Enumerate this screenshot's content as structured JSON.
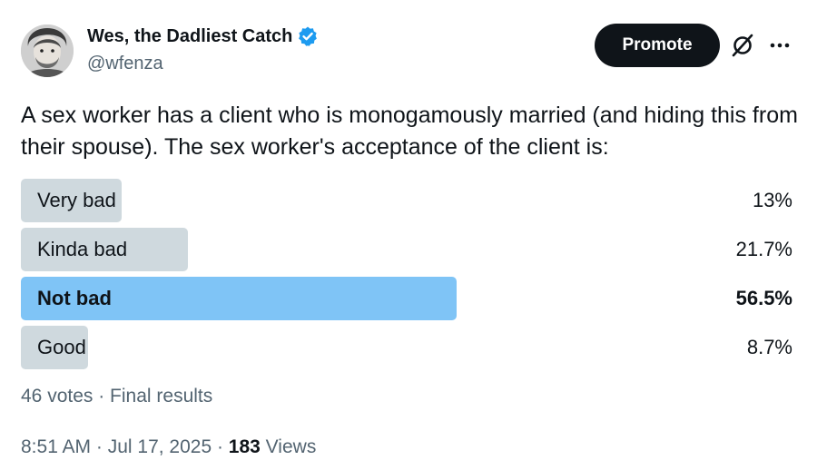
{
  "author": {
    "display_name": "Wes, the Dadliest Catch",
    "handle": "@wfenza",
    "verified": true
  },
  "actions": {
    "promote_label": "Promote",
    "icons": [
      "grok-icon",
      "more-icon"
    ]
  },
  "tweet": {
    "text": "A sex worker has a client who is monogamously married (and hiding this from their spouse). The sex worker's acceptance of the client is:"
  },
  "poll": {
    "options": [
      {
        "label": "Very bad",
        "percent_text": "13%",
        "percent": 13,
        "winner": false
      },
      {
        "label": "Kinda bad",
        "percent_text": "21.7%",
        "percent": 21.7,
        "winner": false
      },
      {
        "label": "Not bad",
        "percent_text": "56.5%",
        "percent": 56.5,
        "winner": true
      },
      {
        "label": "Good",
        "percent_text": "8.7%",
        "percent": 8.7,
        "winner": false
      }
    ],
    "summary": "46 votes · Final results"
  },
  "meta": {
    "timestamp": "8:51 AM · Jul 17, 2025 · ",
    "views_count": "183",
    "views_label": " Views"
  },
  "colors": {
    "bar": "#cfd9de",
    "winner_bar": "#7fc4f6",
    "verified": "#1d9bf0",
    "muted_text": "#536471"
  }
}
